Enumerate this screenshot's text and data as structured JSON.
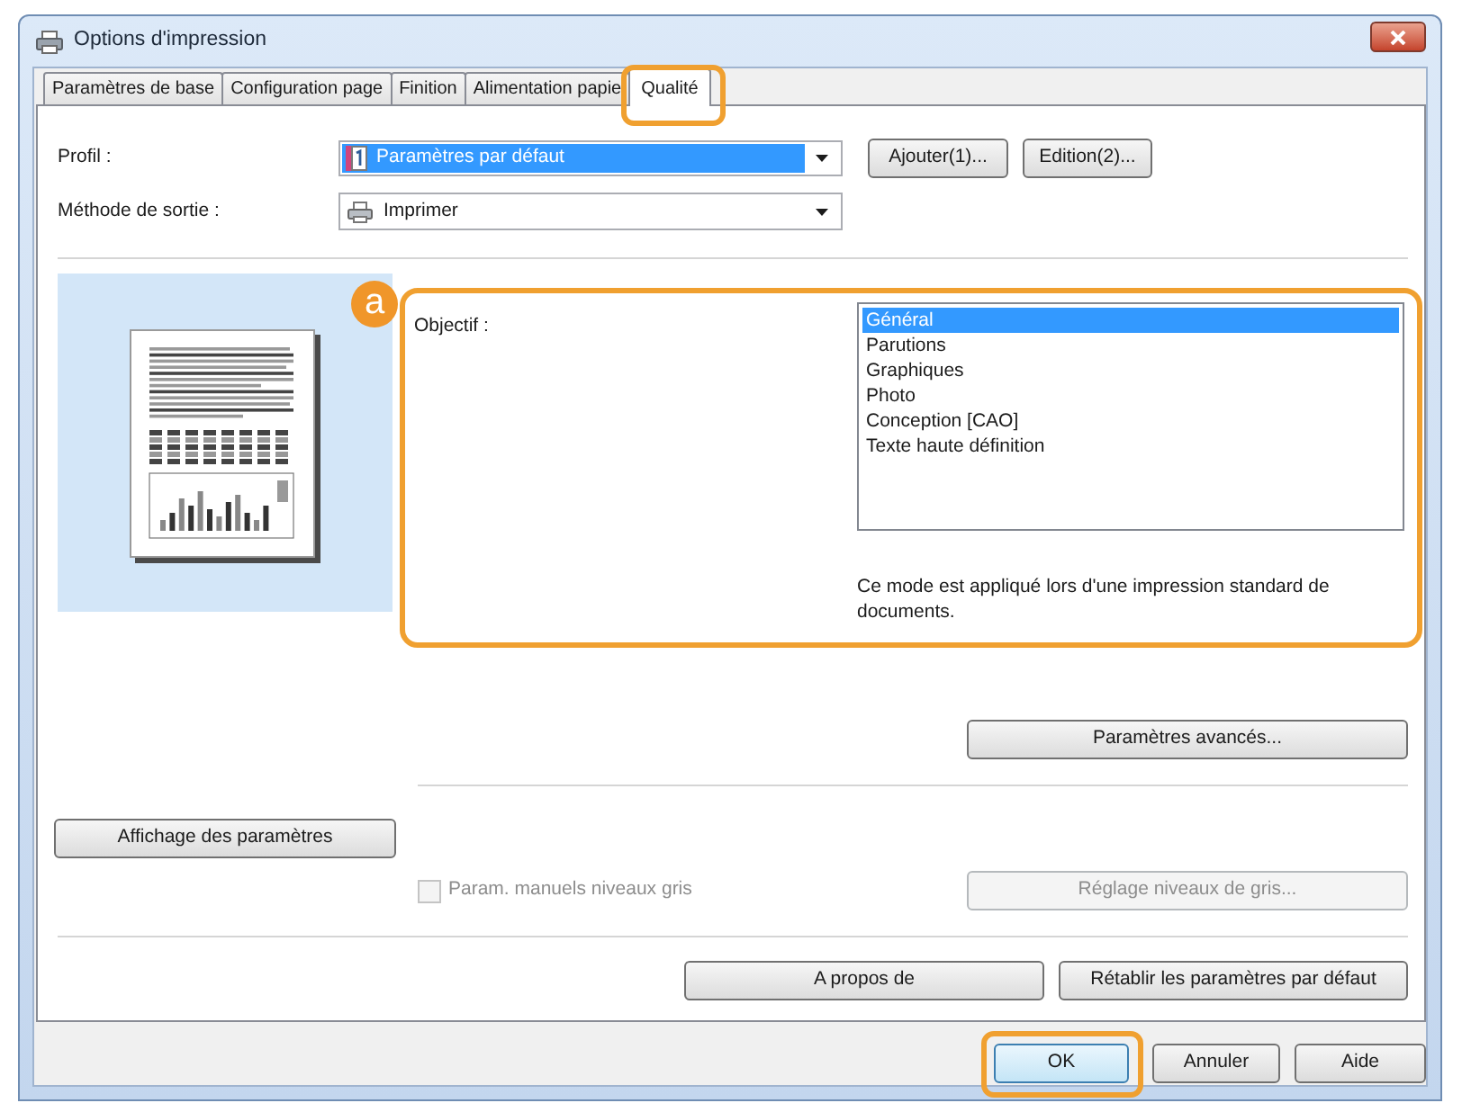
{
  "window": {
    "title": "Options d'impression"
  },
  "tabs": [
    {
      "label": "Paramètres de base",
      "selected": false,
      "highlighted": false
    },
    {
      "label": "Configuration page",
      "selected": false,
      "highlighted": false
    },
    {
      "label": "Finition",
      "selected": false,
      "highlighted": false
    },
    {
      "label": "Alimentation papie",
      "selected": false,
      "highlighted": false
    },
    {
      "label": "Qualité",
      "selected": true,
      "highlighted": true
    }
  ],
  "profile": {
    "label": "Profil :",
    "value": "Paramètres par défaut",
    "focused": true,
    "buttons": [
      "Ajouter(1)...",
      "Edition(2)..."
    ]
  },
  "output_method": {
    "label": "Méthode de sortie :",
    "value": "Imprimer"
  },
  "preview": {
    "callout": "a"
  },
  "objective": {
    "label": "Objectif :",
    "highlighted": true,
    "options": [
      {
        "label": "Général",
        "selected": true
      },
      {
        "label": "Parutions",
        "selected": false
      },
      {
        "label": "Graphiques",
        "selected": false
      },
      {
        "label": "Photo",
        "selected": false
      },
      {
        "label": "Conception [CAO]",
        "selected": false
      },
      {
        "label": "Texte haute définition",
        "selected": false
      }
    ],
    "description": "Ce mode est appliqué lors d'une impression standard de documents."
  },
  "advanced_button": {
    "label": "Paramètres avancés..."
  },
  "settings_display_button": {
    "label": "Affichage des paramètres"
  },
  "manual_gray": {
    "label": "Param. manuels niveaux gris",
    "checked": false,
    "disabled": true
  },
  "gray_adjust_button": {
    "label": "Réglage niveaux de gris...",
    "disabled": true
  },
  "panel_buttons": [
    {
      "label": "A propos de"
    },
    {
      "label": "Rétablir les paramètres par défaut"
    }
  ],
  "dialog_buttons": [
    {
      "label": "OK",
      "default": true,
      "highlighted": true
    },
    {
      "label": "Annuler",
      "default": false,
      "highlighted": false
    },
    {
      "label": "Aide",
      "default": false,
      "highlighted": false
    }
  ]
}
